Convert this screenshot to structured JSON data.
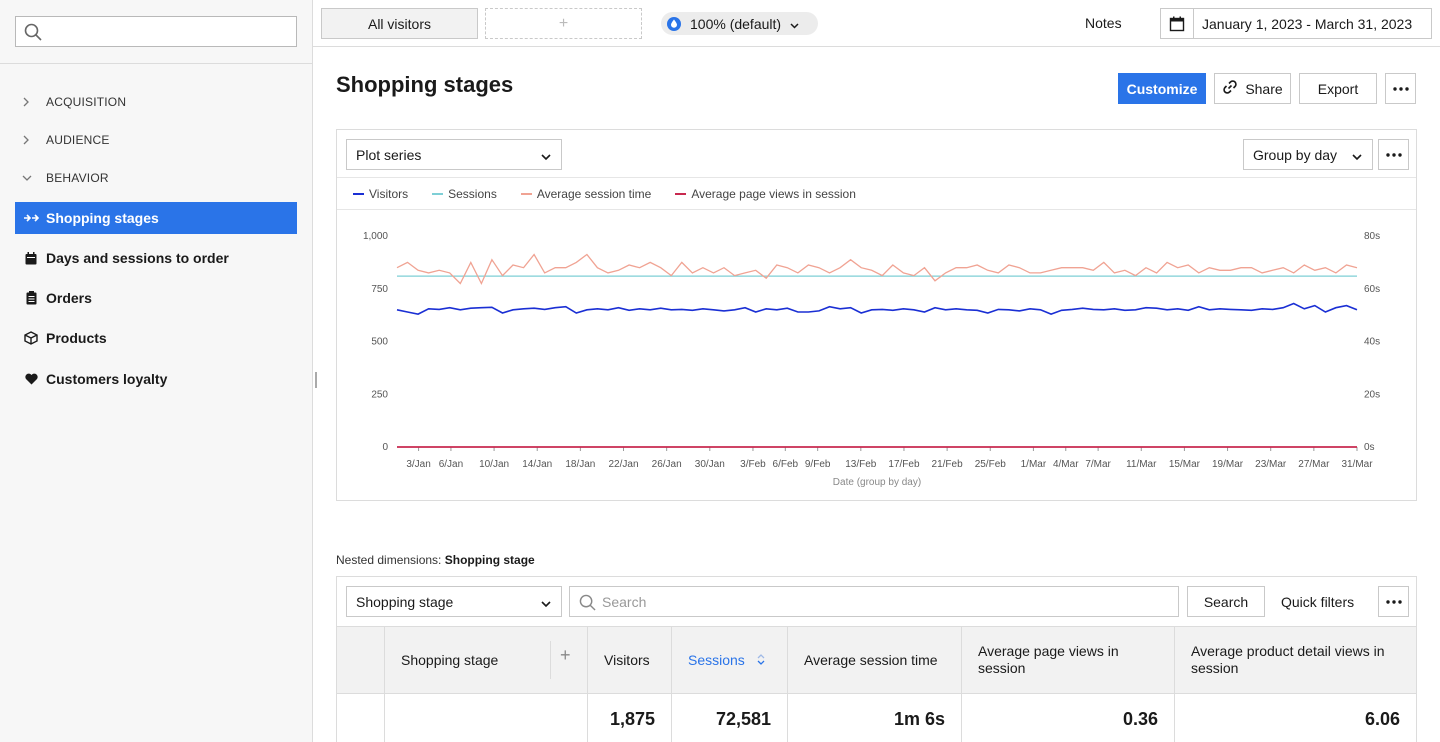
{
  "sidebar": {
    "search_placeholder": "",
    "groups": [
      {
        "label": "ACQUISITION",
        "state": "collapsed"
      },
      {
        "label": "AUDIENCE",
        "state": "collapsed"
      },
      {
        "label": "BEHAVIOR",
        "state": "expanded"
      }
    ],
    "items": [
      {
        "label": "Shopping stages",
        "icon": "funnel-arrows-icon",
        "active": true
      },
      {
        "label": "Days and sessions to order",
        "icon": "calendar-icon",
        "active": false
      },
      {
        "label": "Orders",
        "icon": "clipboard-icon",
        "active": false
      },
      {
        "label": "Products",
        "icon": "box-icon",
        "active": false
      },
      {
        "label": "Customers loyalty",
        "icon": "heart-icon",
        "active": false
      }
    ]
  },
  "topbar": {
    "segment_label": "All visitors",
    "add_segment": "+",
    "sampling_label": "100% (default)",
    "notes_label": "Notes",
    "date_range": "January 1, 2023 - March 31, 2023"
  },
  "header": {
    "title": "Shopping stages",
    "customize_label": "Customize",
    "share_label": "Share",
    "export_label": "Export"
  },
  "chart_controls": {
    "plot_series_label": "Plot series",
    "group_by_label": "Group by day"
  },
  "colors": {
    "accent": "#2a74e8",
    "visitors": "#1a2fd4",
    "sessions": "#7ecfd6",
    "avg_session_time": "#f0a393",
    "avg_page_views": "#c8294f"
  },
  "chart_data": {
    "type": "line",
    "xlabel": "Date (group by day)",
    "x_range": [
      "2023-01-01",
      "2023-03-31"
    ],
    "x_tick_labels": [
      "3/Jan",
      "6/Jan",
      "10/Jan",
      "14/Jan",
      "18/Jan",
      "22/Jan",
      "26/Jan",
      "30/Jan",
      "3/Feb",
      "6/Feb",
      "9/Feb",
      "13/Feb",
      "17/Feb",
      "21/Feb",
      "25/Feb",
      "1/Mar",
      "4/Mar",
      "7/Mar",
      "11/Mar",
      "15/Mar",
      "19/Mar",
      "23/Mar",
      "27/Mar",
      "31/Mar"
    ],
    "y_left": {
      "ticks": [
        "0",
        "250",
        "500",
        "750",
        "1,000"
      ],
      "range": [
        0,
        1000
      ]
    },
    "y_right": {
      "ticks": [
        "0s",
        "20s",
        "40s",
        "60s",
        "80s"
      ],
      "range": [
        0,
        80
      ]
    },
    "grid": false,
    "legend_position": "top-left",
    "series": [
      {
        "name": "Visitors",
        "axis": "left",
        "values": [
          650,
          640,
          630,
          655,
          652,
          660,
          650,
          658,
          660,
          662,
          635,
          650,
          655,
          658,
          652,
          660,
          665,
          635,
          650,
          655,
          650,
          660,
          648,
          655,
          650,
          658,
          650,
          652,
          648,
          655,
          650,
          645,
          650,
          660,
          640,
          655,
          650,
          658,
          640,
          640,
          645,
          665,
          655,
          660,
          635,
          650,
          652,
          648,
          655,
          650,
          640,
          660,
          650,
          655,
          650,
          648,
          635,
          652,
          650,
          645,
          655,
          650,
          630,
          648,
          652,
          658,
          652,
          650,
          655,
          648,
          650,
          660,
          658,
          650,
          655,
          648,
          665,
          650,
          655,
          652,
          650,
          648,
          655,
          652,
          660,
          680,
          655,
          670,
          640,
          660,
          670,
          650
        ]
      },
      {
        "name": "Sessions",
        "axis": "left",
        "values": [
          810,
          810,
          810,
          810,
          810,
          810,
          810,
          810,
          810,
          810,
          810,
          810,
          810,
          810,
          810,
          810,
          810,
          810,
          810,
          810,
          810,
          810,
          810,
          810,
          810,
          810,
          810,
          810,
          810,
          810,
          810,
          810,
          810,
          810,
          810,
          810,
          810,
          810,
          810,
          810,
          810,
          810,
          810,
          810,
          810,
          810,
          810,
          810,
          810,
          810,
          810,
          810,
          810,
          810,
          810,
          810,
          810,
          810,
          810,
          810,
          810,
          810,
          810,
          810,
          810,
          810,
          810,
          810,
          810,
          810,
          810,
          810,
          810,
          810,
          810,
          810,
          810,
          810,
          810,
          810,
          810,
          810,
          810,
          810,
          810,
          810,
          810,
          810,
          810,
          810,
          810,
          810
        ]
      },
      {
        "name": "Average session time",
        "axis": "right",
        "values": [
          68,
          70,
          67,
          66,
          67,
          66,
          62,
          70,
          62,
          71,
          65,
          69,
          68,
          73,
          66,
          68,
          68,
          70,
          73,
          68,
          66,
          67,
          69,
          68,
          70,
          68,
          65,
          70,
          66,
          68,
          66,
          68,
          65,
          66,
          67,
          64,
          69,
          68,
          66,
          69,
          68,
          66,
          68,
          71,
          68,
          67,
          65,
          69,
          66,
          65,
          68,
          63,
          66,
          68,
          68,
          69,
          67,
          66,
          69,
          68,
          66,
          66,
          67,
          68,
          68,
          68,
          67,
          70,
          66,
          67,
          65,
          68,
          66,
          70,
          68,
          69,
          66,
          68,
          67,
          67,
          68,
          68,
          66,
          67,
          68,
          66,
          69,
          67,
          68,
          66,
          69,
          68
        ]
      },
      {
        "name": "Average page views in session",
        "axis": "left",
        "values": [
          0,
          0,
          0,
          0,
          0,
          0,
          0,
          0,
          0,
          0,
          0,
          0,
          0,
          0,
          0,
          0,
          0,
          0,
          0,
          0,
          0,
          0,
          0,
          0,
          0,
          0,
          0,
          0,
          0,
          0,
          0,
          0,
          0,
          0,
          0,
          0,
          0,
          0,
          0,
          0,
          0,
          0,
          0,
          0,
          0,
          0,
          0,
          0,
          0,
          0,
          0,
          0,
          0,
          0,
          0,
          0,
          0,
          0,
          0,
          0,
          0,
          0,
          0,
          0,
          0,
          0,
          0,
          0,
          0,
          0,
          0,
          0,
          0,
          0,
          0,
          0,
          0,
          0,
          0,
          0,
          0,
          0,
          0,
          0,
          0,
          0,
          0,
          0,
          0,
          0,
          0,
          0
        ]
      }
    ]
  },
  "nested": {
    "label": "Nested dimensions:",
    "value": "Shopping stage"
  },
  "table": {
    "dimension_label": "Shopping stage",
    "search_placeholder": "Search",
    "search_button": "Search",
    "quick_filters": "Quick filters",
    "add_column": "+",
    "columns": [
      "Shopping stage",
      "Visitors",
      "Sessions",
      "Average session time",
      "Average page views in session",
      "Average product detail views in session"
    ],
    "totals": {
      "visitors": "1,875",
      "sessions": "72,581",
      "avg_session_time": "1m 6s",
      "avg_page_views": "0.36",
      "avg_product_views": "6.06"
    }
  }
}
